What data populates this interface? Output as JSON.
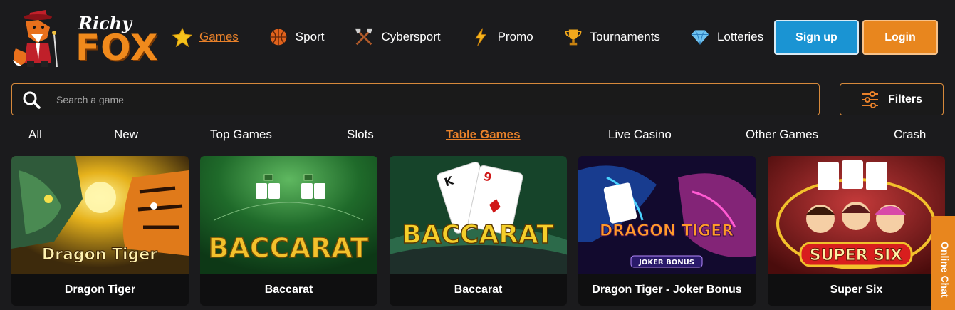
{
  "brand": {
    "line1": "Richy",
    "line2": "FOX"
  },
  "nav": [
    {
      "label": "Games",
      "icon": "star-icon",
      "active": true
    },
    {
      "label": "Sport",
      "icon": "basketball-icon",
      "active": false
    },
    {
      "label": "Cybersport",
      "icon": "crossed-axes-icon",
      "active": false
    },
    {
      "label": "Promo",
      "icon": "lightning-icon",
      "active": false
    },
    {
      "label": "Tournaments",
      "icon": "trophy-icon",
      "active": false
    },
    {
      "label": "Lotteries",
      "icon": "diamond-icon",
      "active": false
    }
  ],
  "auth": {
    "signup_label": "Sign up",
    "login_label": "Login"
  },
  "search": {
    "placeholder": "Search a game",
    "value": ""
  },
  "filters": {
    "label": "Filters"
  },
  "categories": [
    {
      "label": "All",
      "active": false
    },
    {
      "label": "New",
      "active": false
    },
    {
      "label": "Top Games",
      "active": false
    },
    {
      "label": "Slots",
      "active": false
    },
    {
      "label": "Table Games",
      "active": true
    },
    {
      "label": "Live Casino",
      "active": false
    },
    {
      "label": "Other Games",
      "active": false
    },
    {
      "label": "Crash",
      "active": false
    }
  ],
  "games": [
    {
      "title": "Dragon Tiger",
      "art_text": "Dragon Tiger"
    },
    {
      "title": "Baccarat",
      "art_text": "BACCARAT"
    },
    {
      "title": "Baccarat",
      "art_text": "BACCARAT"
    },
    {
      "title": "Dragon Tiger - Joker Bonus",
      "art_text": "DRAGON TIGER",
      "art_subtext": "JOKER BONUS"
    },
    {
      "title": "Super Six",
      "art_text": "SUPER SIX"
    }
  ],
  "chat": {
    "label": "Online Chat"
  },
  "colors": {
    "accent": "#e8812a",
    "signup": "#1a94d3",
    "login": "#e8861e",
    "background": "#1b1b1d"
  }
}
